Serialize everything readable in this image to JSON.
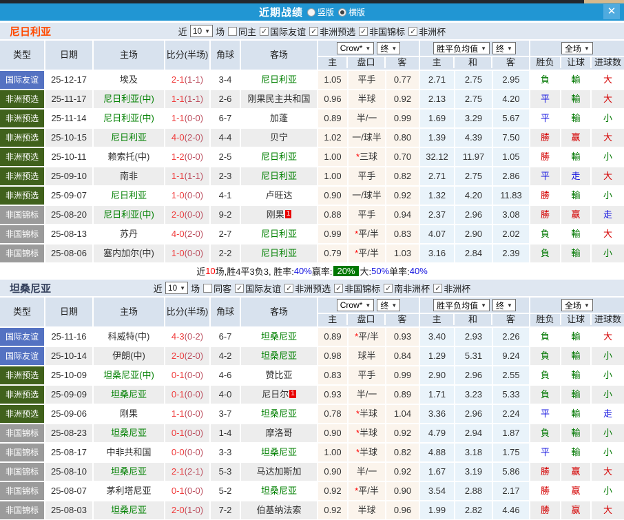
{
  "title_bar": {
    "title": "近期战绩",
    "vertical_label": "竖版",
    "horizontal_label": "横版",
    "selected_layout": "横版"
  },
  "icons": {
    "dropdown": "▼",
    "check": "✓",
    "close": "✕"
  },
  "selects": {
    "odds_company": "Crow*",
    "final": "终",
    "mean": "胜平负均值",
    "scope": "全场"
  },
  "columns": {
    "type": "类型",
    "date": "日期",
    "home": "主场",
    "score": "比分(半场)",
    "corner": "角球",
    "away": "客场",
    "odds_home": "主",
    "odds_hcp": "盘口",
    "odds_away": "客",
    "mean_home": "主",
    "mean_draw": "和",
    "mean_away": "客",
    "res_wdl": "胜负",
    "res_hcp": "让球",
    "res_goal": "进球数"
  },
  "type_colors": {
    "国际友谊": "#5472c2",
    "非洲预选": "#40611c",
    "非国锦标": "#9b9b9b"
  },
  "result_colors": {
    "勝": "#d40000",
    "赢": "#d40000",
    "大": "#d40000",
    "平": "#1414e0",
    "走": "#1414e0",
    "負": "#007700",
    "輸": "#007700",
    "小": "#007700"
  },
  "sections": [
    {
      "team": "尼日利亚",
      "team_color": "#ff4a00",
      "filter": {
        "near_label": "近",
        "count": "10",
        "unit_label": "场",
        "same": {
          "label": "同主",
          "checked": false
        },
        "competitions": [
          {
            "label": "国际友谊",
            "checked": true
          },
          {
            "label": "非洲预选",
            "checked": true
          },
          {
            "label": "非国锦标",
            "checked": true
          },
          {
            "label": "非洲杯",
            "checked": true
          }
        ]
      },
      "rows": [
        {
          "type": "国际友谊",
          "date": "25-12-17",
          "home": "埃及",
          "home_team": false,
          "score": "2-1",
          "half": "(1-1)",
          "corner": "3-4",
          "away": "尼日利亚",
          "away_team": true,
          "o1": "1.05",
          "hcp": "平手",
          "hcp_star": false,
          "o2": "0.77",
          "m1": "2.71",
          "m2": "2.75",
          "m3": "2.95",
          "r1": "負",
          "r2": "輸",
          "r3": "大"
        },
        {
          "type": "非洲预选",
          "date": "25-11-17",
          "home": "尼日利亚(中)",
          "home_team": true,
          "score": "1-1",
          "half": "(1-1)",
          "corner": "2-6",
          "away": "刚果民主共和国",
          "away_team": false,
          "o1": "0.96",
          "hcp": "半球",
          "hcp_star": false,
          "o2": "0.92",
          "m1": "2.13",
          "m2": "2.75",
          "m3": "4.20",
          "r1": "平",
          "r2": "輸",
          "r3": "大"
        },
        {
          "type": "非洲预选",
          "date": "25-11-14",
          "home": "尼日利亚(中)",
          "home_team": true,
          "score": "1-1",
          "half": "(0-0)",
          "corner": "6-7",
          "away": "加蓬",
          "away_team": false,
          "o1": "0.89",
          "hcp": "半/一",
          "hcp_star": false,
          "o2": "0.99",
          "m1": "1.69",
          "m2": "3.29",
          "m3": "5.67",
          "r1": "平",
          "r2": "輸",
          "r3": "小"
        },
        {
          "type": "非洲预选",
          "date": "25-10-15",
          "home": "尼日利亚",
          "home_team": true,
          "score": "4-0",
          "half": "(2-0)",
          "corner": "4-4",
          "away": "贝宁",
          "away_team": false,
          "o1": "1.02",
          "hcp": "一/球半",
          "hcp_star": false,
          "o2": "0.80",
          "m1": "1.39",
          "m2": "4.39",
          "m3": "7.50",
          "r1": "勝",
          "r2": "赢",
          "r3": "大"
        },
        {
          "type": "非洲预选",
          "date": "25-10-11",
          "home": "赖索托(中)",
          "home_team": false,
          "score": "1-2",
          "half": "(0-0)",
          "corner": "2-5",
          "away": "尼日利亚",
          "away_team": true,
          "o1": "1.00",
          "hcp": "三球",
          "hcp_star": true,
          "o2": "0.70",
          "m1": "32.12",
          "m2": "11.97",
          "m3": "1.05",
          "r1": "勝",
          "r2": "輸",
          "r3": "小"
        },
        {
          "type": "非洲预选",
          "date": "25-09-10",
          "home": "南非",
          "home_team": false,
          "score": "1-1",
          "half": "(1-1)",
          "corner": "2-3",
          "away": "尼日利亚",
          "away_team": true,
          "o1": "1.00",
          "hcp": "平手",
          "hcp_star": false,
          "o2": "0.82",
          "m1": "2.71",
          "m2": "2.75",
          "m3": "2.86",
          "r1": "平",
          "r2": "走",
          "r3": "大"
        },
        {
          "type": "非洲预选",
          "date": "25-09-07",
          "home": "尼日利亚",
          "home_team": true,
          "score": "1-0",
          "half": "(0-0)",
          "corner": "4-1",
          "away": "卢旺达",
          "away_team": false,
          "o1": "0.90",
          "hcp": "一/球半",
          "hcp_star": false,
          "o2": "0.92",
          "m1": "1.32",
          "m2": "4.20",
          "m3": "11.83",
          "r1": "勝",
          "r2": "輸",
          "r3": "小"
        },
        {
          "type": "非国锦标",
          "date": "25-08-20",
          "home": "尼日利亚(中)",
          "home_team": true,
          "score": "2-0",
          "half": "(0-0)",
          "corner": "9-2",
          "away": "刚果",
          "away_team": false,
          "away_card": "1",
          "o1": "0.88",
          "hcp": "平手",
          "hcp_star": false,
          "o2": "0.94",
          "m1": "2.37",
          "m2": "2.96",
          "m3": "3.08",
          "r1": "勝",
          "r2": "赢",
          "r3": "走"
        },
        {
          "type": "非国锦标",
          "date": "25-08-13",
          "home": "苏丹",
          "home_team": false,
          "score": "4-0",
          "half": "(2-0)",
          "corner": "2-7",
          "away": "尼日利亚",
          "away_team": true,
          "o1": "0.99",
          "hcp": "平/半",
          "hcp_star": true,
          "o2": "0.83",
          "m1": "4.07",
          "m2": "2.90",
          "m3": "2.02",
          "r1": "負",
          "r2": "輸",
          "r3": "大"
        },
        {
          "type": "非国锦标",
          "date": "25-08-06",
          "home": "塞内加尔(中)",
          "home_team": false,
          "score": "1-0",
          "half": "(0-0)",
          "corner": "2-2",
          "away": "尼日利亚",
          "away_team": true,
          "o1": "0.79",
          "hcp": "平/半",
          "hcp_star": true,
          "o2": "1.03",
          "m1": "3.16",
          "m2": "2.84",
          "m3": "2.39",
          "r1": "負",
          "r2": "輸",
          "r3": "小"
        }
      ],
      "summary_parts": [
        {
          "t": "近",
          "c": "k"
        },
        {
          "t": "10",
          "c": "r"
        },
        {
          "t": "场,胜4平3负3, 胜率:",
          "c": "k"
        },
        {
          "t": "40%",
          "c": "b"
        },
        {
          "t": " 赢率:",
          "c": "k"
        },
        {
          "t": "20%",
          "c": "g"
        },
        {
          "t": " 大:",
          "c": "k"
        },
        {
          "t": "50%",
          "c": "b"
        },
        {
          "t": " 单率:",
          "c": "k"
        },
        {
          "t": "40%",
          "c": "b"
        }
      ]
    },
    {
      "team": "坦桑尼亚",
      "team_color": "#34405c",
      "filter": {
        "near_label": "近",
        "count": "10",
        "unit_label": "场",
        "same": {
          "label": "同客",
          "checked": false
        },
        "competitions": [
          {
            "label": "国际友谊",
            "checked": true
          },
          {
            "label": "非洲预选",
            "checked": true
          },
          {
            "label": "非国锦标",
            "checked": true
          },
          {
            "label": "南非洲杯",
            "checked": true
          },
          {
            "label": "非洲杯",
            "checked": true
          }
        ]
      },
      "rows": [
        {
          "type": "国际友谊",
          "date": "25-11-16",
          "home": "科威特(中)",
          "home_team": false,
          "score": "4-3",
          "half": "(0-2)",
          "corner": "6-7",
          "away": "坦桑尼亚",
          "away_team": true,
          "o1": "0.89",
          "hcp": "平/半",
          "hcp_star": true,
          "o2": "0.93",
          "m1": "3.40",
          "m2": "2.93",
          "m3": "2.26",
          "r1": "負",
          "r2": "輸",
          "r3": "大"
        },
        {
          "type": "国际友谊",
          "date": "25-10-14",
          "home": "伊朗(中)",
          "home_team": false,
          "score": "2-0",
          "half": "(2-0)",
          "corner": "4-2",
          "away": "坦桑尼亚",
          "away_team": true,
          "o1": "0.98",
          "hcp": "球半",
          "hcp_star": false,
          "o2": "0.84",
          "m1": "1.29",
          "m2": "5.31",
          "m3": "9.24",
          "r1": "負",
          "r2": "輸",
          "r3": "小"
        },
        {
          "type": "非洲预选",
          "date": "25-10-09",
          "home": "坦桑尼亚(中)",
          "home_team": true,
          "score": "0-1",
          "half": "(0-0)",
          "corner": "4-6",
          "away": "赞比亚",
          "away_team": false,
          "o1": "0.83",
          "hcp": "平手",
          "hcp_star": false,
          "o2": "0.99",
          "m1": "2.90",
          "m2": "2.96",
          "m3": "2.55",
          "r1": "負",
          "r2": "輸",
          "r3": "小"
        },
        {
          "type": "非洲预选",
          "date": "25-09-09",
          "home": "坦桑尼亚",
          "home_team": true,
          "score": "0-1",
          "half": "(0-0)",
          "corner": "4-0",
          "away": "尼日尔",
          "away_team": false,
          "away_card": "1",
          "o1": "0.93",
          "hcp": "半/一",
          "hcp_star": false,
          "o2": "0.89",
          "m1": "1.71",
          "m2": "3.23",
          "m3": "5.33",
          "r1": "負",
          "r2": "輸",
          "r3": "小"
        },
        {
          "type": "非洲预选",
          "date": "25-09-06",
          "home": "刚果",
          "home_team": false,
          "score": "1-1",
          "half": "(0-0)",
          "corner": "3-7",
          "away": "坦桑尼亚",
          "away_team": true,
          "o1": "0.78",
          "hcp": "半球",
          "hcp_star": true,
          "o2": "1.04",
          "m1": "3.36",
          "m2": "2.96",
          "m3": "2.24",
          "r1": "平",
          "r2": "輸",
          "r3": "走"
        },
        {
          "type": "非国锦标",
          "date": "25-08-23",
          "home": "坦桑尼亚",
          "home_team": true,
          "score": "0-1",
          "half": "(0-0)",
          "corner": "1-4",
          "away": "摩洛哥",
          "away_team": false,
          "o1": "0.90",
          "hcp": "半球",
          "hcp_star": true,
          "o2": "0.92",
          "m1": "4.79",
          "m2": "2.94",
          "m3": "1.87",
          "r1": "負",
          "r2": "輸",
          "r3": "小"
        },
        {
          "type": "非国锦标",
          "date": "25-08-17",
          "home": "中非共和国",
          "home_team": false,
          "score": "0-0",
          "half": "(0-0)",
          "corner": "3-3",
          "away": "坦桑尼亚",
          "away_team": true,
          "o1": "1.00",
          "hcp": "半球",
          "hcp_star": true,
          "o2": "0.82",
          "m1": "4.88",
          "m2": "3.18",
          "m3": "1.75",
          "r1": "平",
          "r2": "輸",
          "r3": "小"
        },
        {
          "type": "非国锦标",
          "date": "25-08-10",
          "home": "坦桑尼亚",
          "home_team": true,
          "score": "2-1",
          "half": "(2-1)",
          "corner": "5-3",
          "away": "马达加斯加",
          "away_team": false,
          "o1": "0.90",
          "hcp": "半/一",
          "hcp_star": false,
          "o2": "0.92",
          "m1": "1.67",
          "m2": "3.19",
          "m3": "5.86",
          "r1": "勝",
          "r2": "赢",
          "r3": "大"
        },
        {
          "type": "非国锦标",
          "date": "25-08-07",
          "home": "茅利塔尼亚",
          "home_team": false,
          "score": "0-1",
          "half": "(0-0)",
          "corner": "5-2",
          "away": "坦桑尼亚",
          "away_team": true,
          "o1": "0.92",
          "hcp": "平/半",
          "hcp_star": true,
          "o2": "0.90",
          "m1": "3.54",
          "m2": "2.88",
          "m3": "2.17",
          "r1": "勝",
          "r2": "赢",
          "r3": "小"
        },
        {
          "type": "非国锦标",
          "date": "25-08-03",
          "home": "坦桑尼亚",
          "home_team": true,
          "score": "2-0",
          "half": "(1-0)",
          "corner": "7-2",
          "away": "伯基纳法索",
          "away_team": false,
          "o1": "0.92",
          "hcp": "半球",
          "hcp_star": false,
          "o2": "0.96",
          "m1": "1.99",
          "m2": "2.82",
          "m3": "4.46",
          "r1": "勝",
          "r2": "赢",
          "r3": "大"
        }
      ],
      "summary_parts": []
    }
  ]
}
